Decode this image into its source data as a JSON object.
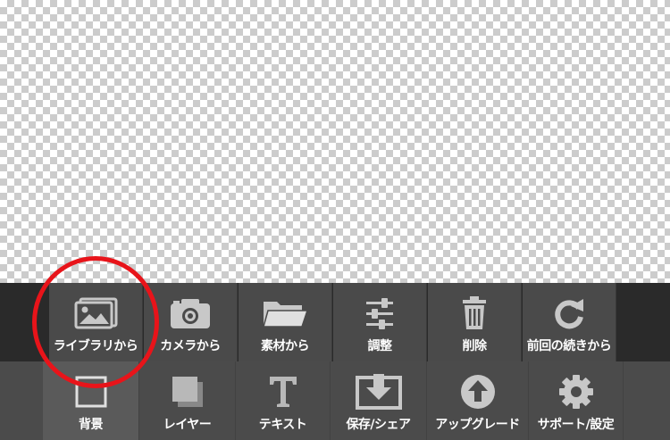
{
  "toolbar_top": {
    "items": [
      {
        "label": "ライブラリから",
        "icon": "image-icon"
      },
      {
        "label": "カメラから",
        "icon": "camera-icon"
      },
      {
        "label": "素材から",
        "icon": "folder-icon"
      },
      {
        "label": "調整",
        "icon": "sliders-icon"
      },
      {
        "label": "削除",
        "icon": "trash-icon"
      },
      {
        "label": "前回の続きから",
        "icon": "redo-icon"
      }
    ]
  },
  "toolbar_bottom": {
    "items": [
      {
        "label": "背景",
        "icon": "square-icon",
        "active": true
      },
      {
        "label": "レイヤー",
        "icon": "layers-icon"
      },
      {
        "label": "テキスト",
        "icon": "text-icon"
      },
      {
        "label": "保存/シェア",
        "icon": "save-icon"
      },
      {
        "label": "アップグレード",
        "icon": "upload-icon"
      },
      {
        "label": "サポート/設定",
        "icon": "gear-icon"
      }
    ]
  },
  "highlight": {
    "color": "#e8141a",
    "target": "ライブラリから"
  },
  "colors": {
    "icon": "#c8c8c8",
    "bar_top": "#4a4a4a",
    "bar_bottom": "#4b4b4b"
  }
}
